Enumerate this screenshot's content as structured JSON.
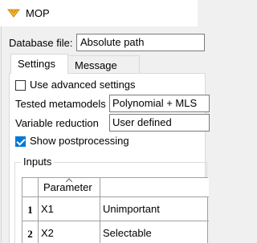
{
  "window": {
    "title": "MOP",
    "icon": "yellow-diamond-icon"
  },
  "database": {
    "label": "Database file:",
    "value": "Absolute path"
  },
  "tabs": [
    {
      "label": "Settings",
      "active": true
    },
    {
      "label": "Message log",
      "active": false
    }
  ],
  "settings": {
    "advanced_label": "Use advanced settings",
    "advanced_checked": false,
    "tested_label": "Tested metamodels",
    "tested_value": "Polynomial + MLS",
    "reduction_label": "Variable reduction",
    "reduction_value": "User defined",
    "postproc_label": "Show postprocessing",
    "postproc_checked": true
  },
  "inputs": {
    "title": "Inputs",
    "columns": [
      "Parameter"
    ],
    "rows": [
      {
        "num": "1",
        "name": "X1",
        "value": "Unimportant"
      },
      {
        "num": "2",
        "name": "X2",
        "value": "Selectable"
      }
    ]
  },
  "colors": {
    "accent": "#0078d7",
    "background": "#f0f0f0",
    "panel": "#ffffff"
  }
}
